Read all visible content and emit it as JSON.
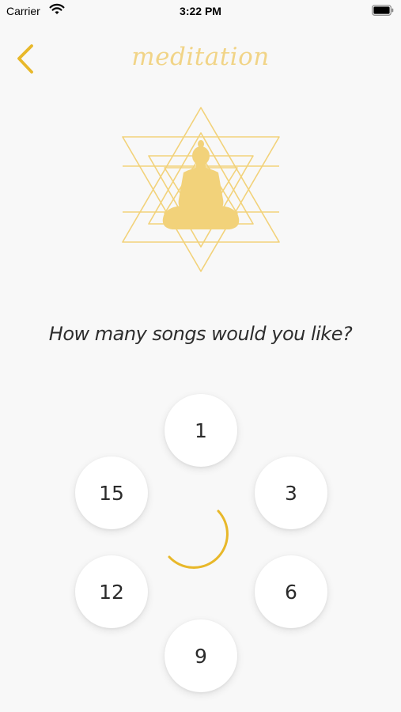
{
  "status_bar": {
    "carrier": "Carrier",
    "time": "3:22 PM",
    "wifi_icon": "wifi-icon",
    "battery_icon": "battery-icon"
  },
  "nav": {
    "back_icon": "chevron-left-icon",
    "title": "meditation"
  },
  "hero": {
    "icon": "buddha-sri-yantra-icon"
  },
  "question": "How many songs would you like?",
  "options": [
    {
      "label": "1"
    },
    {
      "label": "3"
    },
    {
      "label": "6"
    },
    {
      "label": "9"
    },
    {
      "label": "12"
    },
    {
      "label": "15"
    }
  ],
  "center_icon": "crescent-moon-icon",
  "colors": {
    "accent": "#e8b82a",
    "title": "#f1d487",
    "hero": "#f2d27a",
    "background": "#f8f8f8",
    "text": "#2d2d2d"
  }
}
